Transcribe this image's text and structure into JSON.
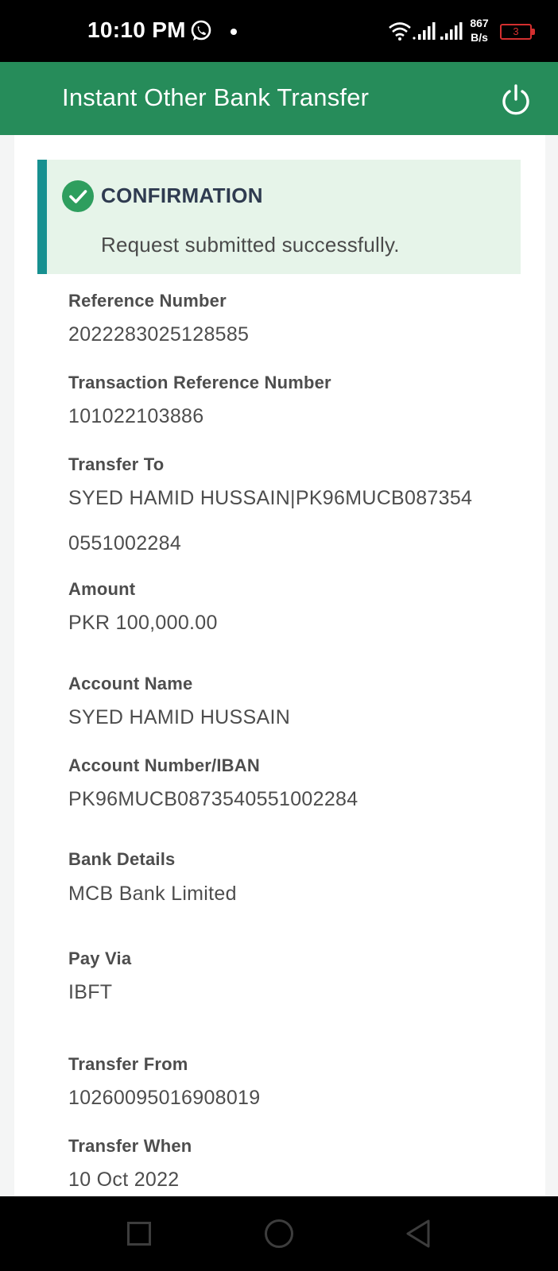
{
  "status_bar": {
    "time": "10:10 PM",
    "speed_value": "867",
    "speed_unit": "B/s",
    "battery": "3",
    "icons": [
      "whatsapp-icon",
      "wifi-icon",
      "signal-icon",
      "signal-icon",
      "battery-icon"
    ]
  },
  "header": {
    "title": "Instant Other Bank Transfer",
    "power_icon": "power-icon"
  },
  "confirmation": {
    "title": "CONFIRMATION",
    "message": "Request submitted successfully.",
    "icon": "check-circle-icon"
  },
  "fields": [
    {
      "label": "Reference Number",
      "value": "2022283025128585"
    },
    {
      "label": "Transaction Reference Number",
      "value": "101022103886"
    },
    {
      "label": "Transfer To",
      "value": "SYED HAMID HUSSAIN|PK96MUCB087354",
      "value2": "0551002284"
    },
    {
      "label": "Amount",
      "value": "PKR 100,000.00"
    },
    {
      "label": "Account Name",
      "value": "SYED HAMID HUSSAIN"
    },
    {
      "label": "Account Number/IBAN",
      "value": "PK96MUCB0873540551002284"
    },
    {
      "label": "Bank Details",
      "value": "MCB Bank Limited"
    },
    {
      "label": "Pay Via",
      "value": "IBFT"
    },
    {
      "label": "Transfer From",
      "value": "10260095016908019"
    },
    {
      "label": "Transfer When",
      "value": "10 Oct 2022"
    }
  ],
  "colors": {
    "header_green": "#268C5A",
    "confirm_bg": "#E6F4E9",
    "confirm_border": "#179090",
    "check_green": "#2E9E5E"
  },
  "nav": {
    "icons": [
      "recent-apps-icon",
      "home-icon",
      "back-icon"
    ]
  }
}
